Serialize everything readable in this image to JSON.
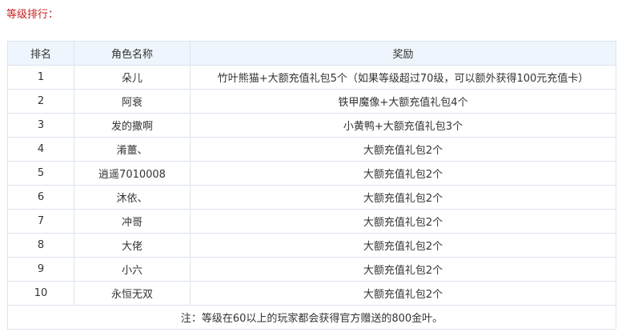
{
  "heading": "等级排行：",
  "table": {
    "headers": [
      "排名",
      "角色名称",
      "奖励"
    ],
    "rows": [
      {
        "rank": "1",
        "name": "朵儿",
        "reward": "竹叶熊猫+大额充值礼包5个（如果等级超过70级，可以额外获得100元充值卡）"
      },
      {
        "rank": "2",
        "name": "阿衰",
        "reward": "铁甲魔像+大额充值礼包4个"
      },
      {
        "rank": "3",
        "name": "发的撒啊",
        "reward": "小黄鸭+大额充值礼包3个"
      },
      {
        "rank": "4",
        "name": "淆薑、",
        "reward": "大额充值礼包2个"
      },
      {
        "rank": "5",
        "name": "逍遥7010008",
        "reward": "大额充值礼包2个"
      },
      {
        "rank": "6",
        "name": "沐依、",
        "reward": "大额充值礼包2个"
      },
      {
        "rank": "7",
        "name": "冲哥",
        "reward": "大额充值礼包2个"
      },
      {
        "rank": "8",
        "name": "大佬",
        "reward": "大额充值礼包2个"
      },
      {
        "rank": "9",
        "name": "小六",
        "reward": "大额充值礼包2个"
      },
      {
        "rank": "10",
        "name": "永恒无双",
        "reward": "大额充值礼包2个"
      }
    ],
    "note": "注：等级在60以上的玩家都会获得官方赠送的800金叶。"
  },
  "colors": {
    "heading": "#c81e1e",
    "header_bg": "#eef5fc",
    "border": "#dbe3ee"
  }
}
